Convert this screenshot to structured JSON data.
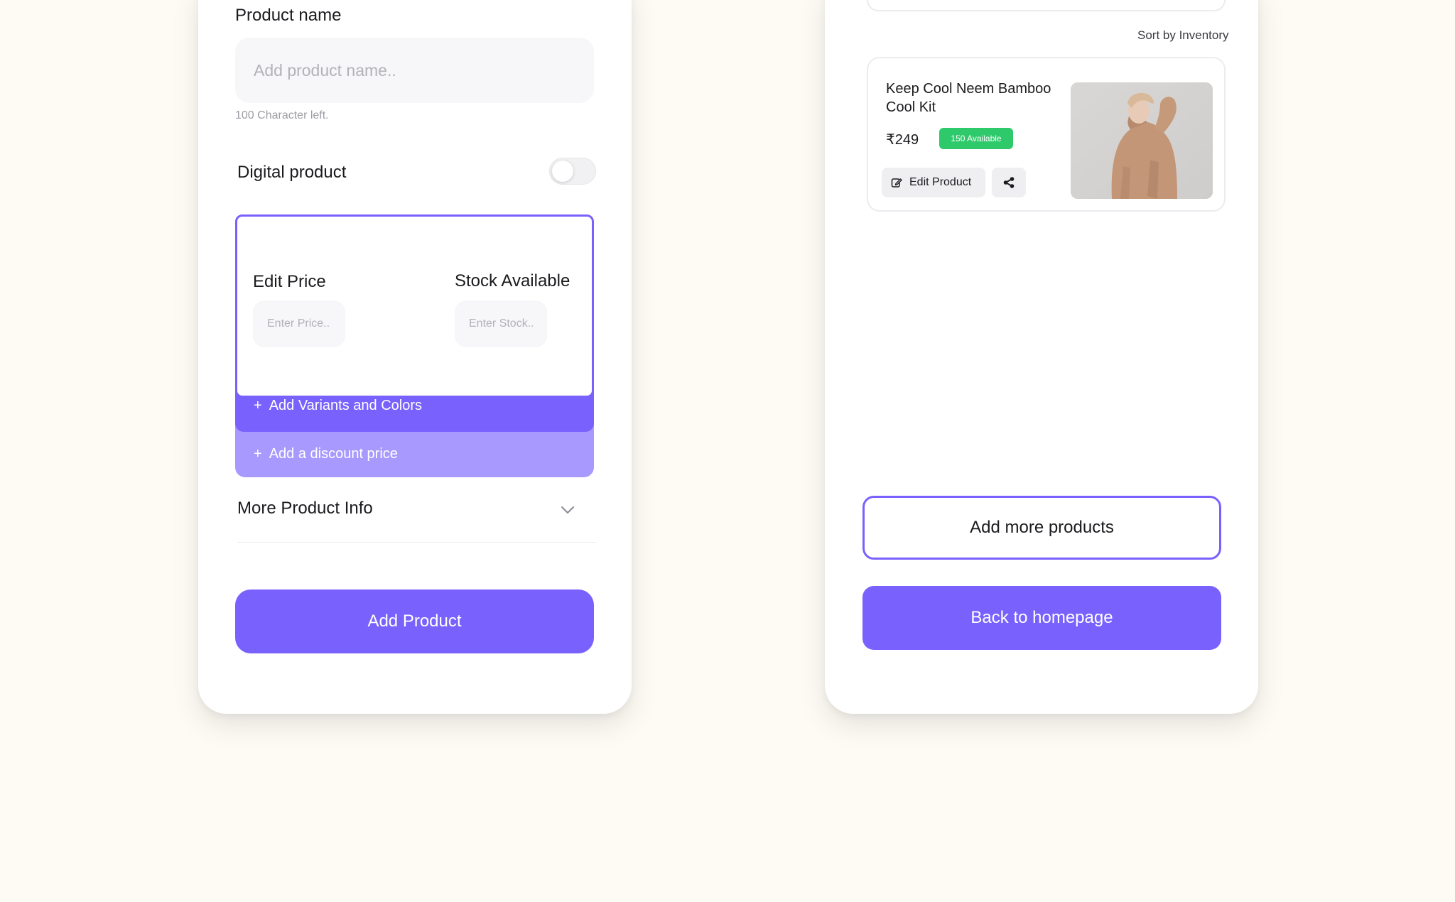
{
  "add_product_screen": {
    "product_name_label": "Product name",
    "product_name_placeholder": "Add product name..",
    "character_left": "100 Character left.",
    "digital_product_label": "Digital product",
    "digital_product_enabled": false,
    "edit_price_label": "Edit Price",
    "price_placeholder": "Enter Price..",
    "stock_label": "Stock Available",
    "stock_placeholder": "Enter Stock..",
    "plus_symbol": "+",
    "add_variants_label": "Add Variants and Colors",
    "add_discount_label": "Add a discount price",
    "more_info_label": "More Product Info",
    "add_product_button": "Add Product"
  },
  "inventory_screen": {
    "sort_label": "Sort by Inventory",
    "product": {
      "title": "Keep Cool Neem Bamboo Cool Kit",
      "price": "₹249",
      "availability": "150 Available",
      "edit_button": "Edit Product"
    },
    "add_more_button": "Add more products",
    "back_home_button": "Back to homepage"
  },
  "colors": {
    "background": "#fefbf5",
    "accent": "#7961fd",
    "accent_light": "#a899ff",
    "available_green": "#2ec96a"
  },
  "icons": {
    "chevron": "chevron-down-icon",
    "edit": "edit-icon",
    "share": "share-icon"
  }
}
